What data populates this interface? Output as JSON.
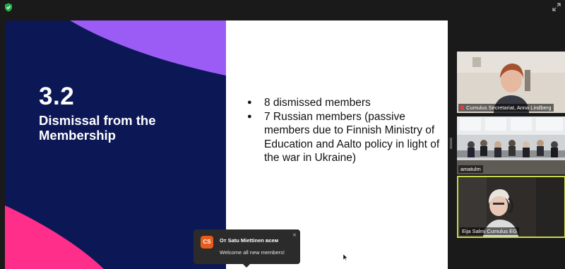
{
  "slide": {
    "number": "3.2",
    "title": "Dismissal from the Membership",
    "bullets": [
      "8 dismissed members",
      "7 Russian members (passive members due to Finnish Ministry of Education and Aalto policy in light of the war in Ukraine)"
    ]
  },
  "participants": [
    {
      "name": "Cumulus Secretariat, Anna Lindberg",
      "muted": true
    },
    {
      "name": "amatulm",
      "muted": false
    },
    {
      "name": "Eija Salmi Cumulus EG",
      "muted": false
    }
  ],
  "chat": {
    "avatar_initials": "CS",
    "from": "От Satu Miettinen всем",
    "message": "Welcome all new members!",
    "close_glyph": "×"
  },
  "colors": {
    "slide_navy": "#0c1755",
    "deco_purple": "#9b5cf6",
    "deco_pink": "#ff2e8a",
    "active_speaker_border": "#c8d94b",
    "avatar_orange": "#ea5a1c"
  },
  "icons": {
    "top_left": "shield-check-icon",
    "top_right": "expand-icon"
  }
}
